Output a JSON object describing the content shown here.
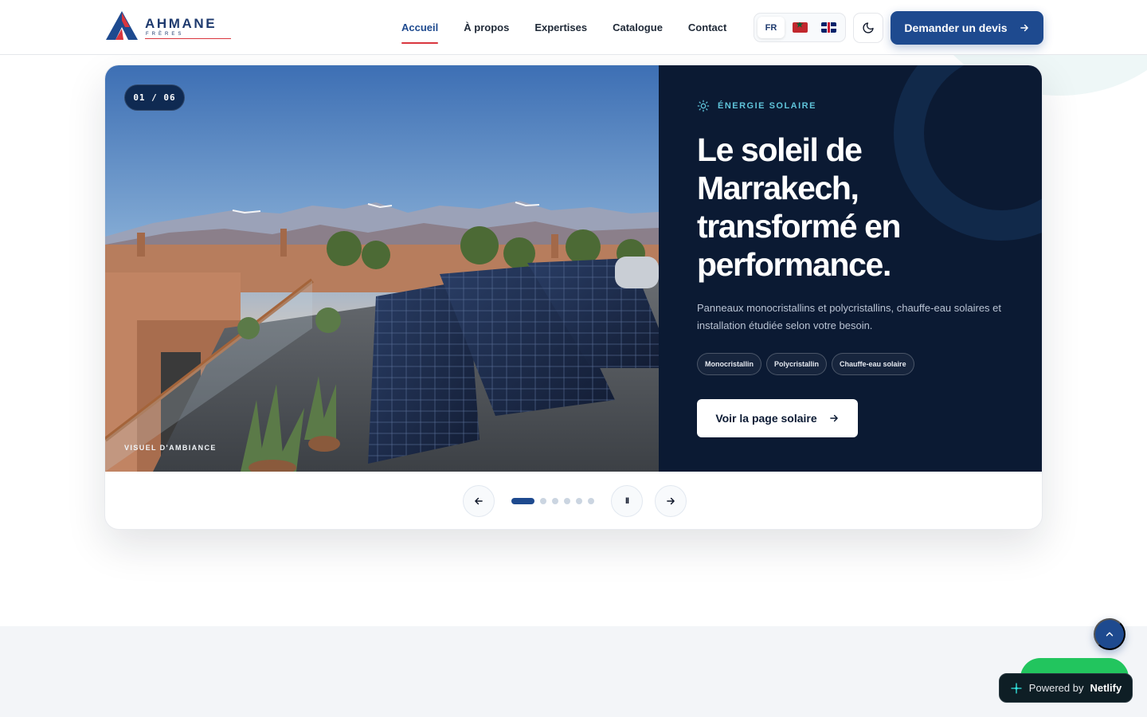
{
  "header": {
    "brand_name": "AHMANE",
    "brand_sub": "FRÈRES",
    "nav": [
      {
        "label": "Accueil",
        "active": true
      },
      {
        "label": "À propos"
      },
      {
        "label": "Expertises"
      },
      {
        "label": "Catalogue"
      },
      {
        "label": "Contact"
      }
    ],
    "lang": {
      "active": "FR",
      "options": [
        "morocco-flag-icon",
        "uk-flag-icon"
      ]
    },
    "theme_icon": "moon-icon",
    "cta_label": "Demander un devis"
  },
  "hero": {
    "counter": "01 / 06",
    "image_caption": "VISUEL D'AMBIANCE",
    "eyebrow": "ÉNERGIE SOLAIRE",
    "title": "Le soleil de Marrakech, transformé en performance.",
    "description": "Panneaux monocristallins et polycristallins, chauffe-eau solaires et installation étudiée selon votre besoin.",
    "tags": [
      "Monocristallin",
      "Polycristallin",
      "Chauffe-eau solaire"
    ],
    "cta_label": "Voir la page solaire",
    "slides_total": 6,
    "active_slide": 1
  },
  "controls": {
    "prev_icon": "arrow-left-icon",
    "pause_label": "II",
    "next_icon": "arrow-right-icon"
  },
  "footer_widgets": {
    "netlify_prefix": "Powered by",
    "netlify_brand": "Netlify"
  },
  "colors": {
    "primary": "#1e4a8f",
    "navy_panel": "#0b1a33",
    "accent_red": "#d9363e",
    "eyebrow_cyan": "#5fc3d9",
    "whatsapp": "#22c55e"
  }
}
